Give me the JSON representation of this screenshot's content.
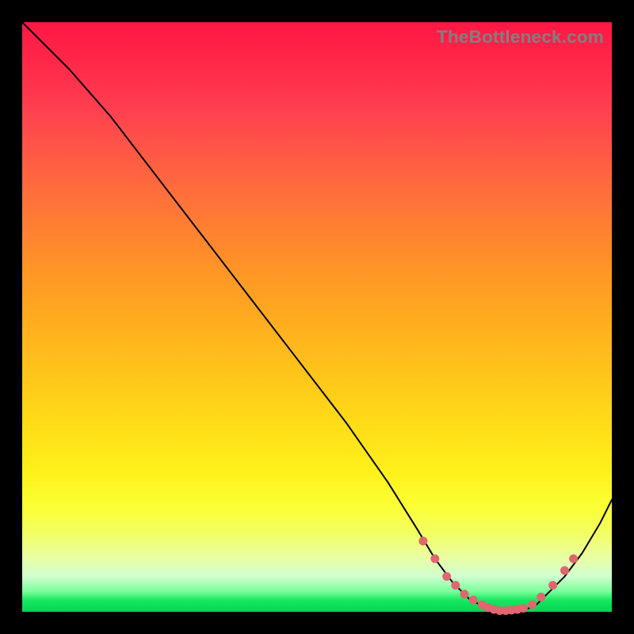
{
  "attribution": "TheBottleneck.com",
  "chart_data": {
    "type": "line",
    "title": "",
    "xlabel": "",
    "ylabel": "",
    "xlim": [
      0,
      100
    ],
    "ylim": [
      0,
      100
    ],
    "grid": false,
    "series": [
      {
        "name": "bottleneck-curve",
        "x": [
          0,
          8,
          15,
          25,
          35,
          45,
          55,
          62,
          67,
          70,
          73,
          76,
          79,
          82,
          85,
          87,
          89,
          92,
          95,
          98,
          100
        ],
        "y": [
          100,
          92,
          84,
          71,
          58,
          45,
          32,
          22,
          14,
          9,
          5,
          2,
          0.6,
          0.2,
          0.3,
          1,
          3,
          6,
          10,
          15,
          19
        ]
      }
    ],
    "markers": {
      "name": "highlight-points",
      "x": [
        68,
        70,
        72,
        73.5,
        75,
        76.5,
        78,
        79,
        80,
        81,
        82,
        83,
        84,
        85,
        86.5,
        88,
        90,
        92,
        93.5
      ],
      "y": [
        12,
        9,
        6,
        4.5,
        3,
        2,
        1.2,
        0.7,
        0.4,
        0.2,
        0.2,
        0.3,
        0.4,
        0.6,
        1.2,
        2.5,
        4.5,
        7,
        9
      ]
    },
    "gradient_stops": [
      {
        "pct": 0,
        "color": "#ff1744"
      },
      {
        "pct": 50,
        "color": "#ffb300"
      },
      {
        "pct": 82,
        "color": "#ffff3a"
      },
      {
        "pct": 100,
        "color": "#00d454"
      }
    ]
  }
}
